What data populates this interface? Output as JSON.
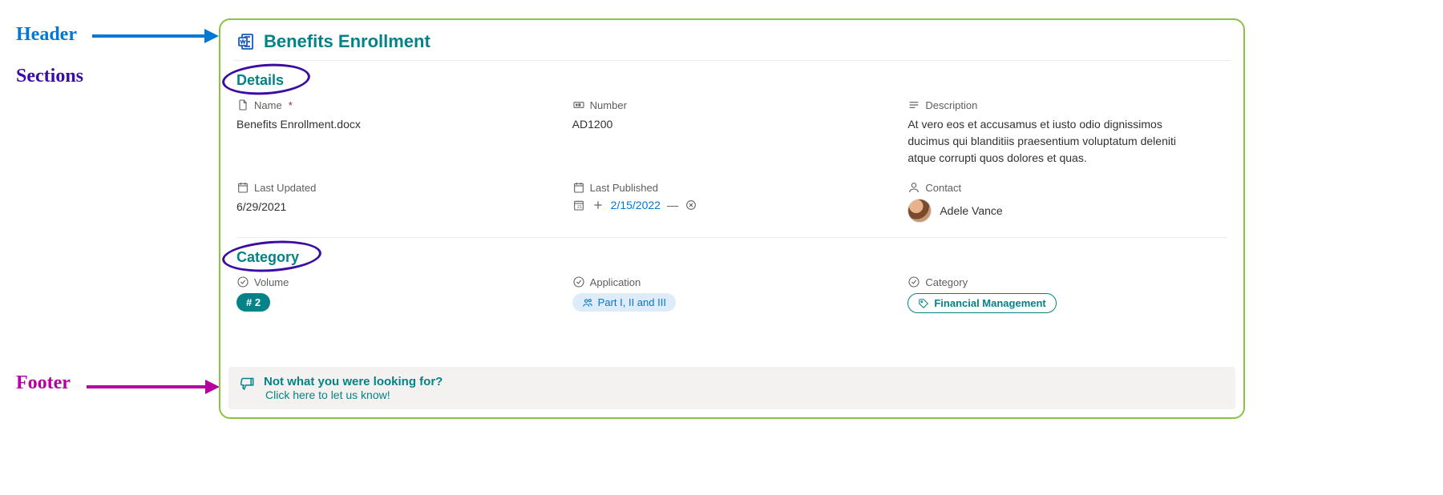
{
  "annotations": {
    "header": "Header",
    "sections": "Sections",
    "footer": "Footer"
  },
  "header": {
    "title": "Benefits Enrollment",
    "icon": "word-document-icon"
  },
  "sections": {
    "details": {
      "title": "Details",
      "fields": {
        "name": {
          "label": "Name",
          "required": true,
          "value": "Benefits Enrollment.docx"
        },
        "number": {
          "label": "Number",
          "value": "AD1200"
        },
        "description": {
          "label": "Description",
          "value": "At vero eos et accusamus et iusto odio dignissimos ducimus qui blanditiis praesentium voluptatum deleniti atque corrupti quos dolores et quas."
        },
        "lastUpdated": {
          "label": "Last Updated",
          "value": "6/29/2021"
        },
        "lastPublished": {
          "label": "Last Published",
          "value": "2/15/2022"
        },
        "contact": {
          "label": "Contact",
          "value": "Adele Vance"
        }
      }
    },
    "category": {
      "title": "Category",
      "fields": {
        "volume": {
          "label": "Volume",
          "value": "# 2"
        },
        "application": {
          "label": "Application",
          "value": "Part I, II and III"
        },
        "category": {
          "label": "Category",
          "value": "Financial Management"
        }
      }
    }
  },
  "footer": {
    "line1": "Not what you were looking for?",
    "line2": "Click here to let us know!"
  }
}
